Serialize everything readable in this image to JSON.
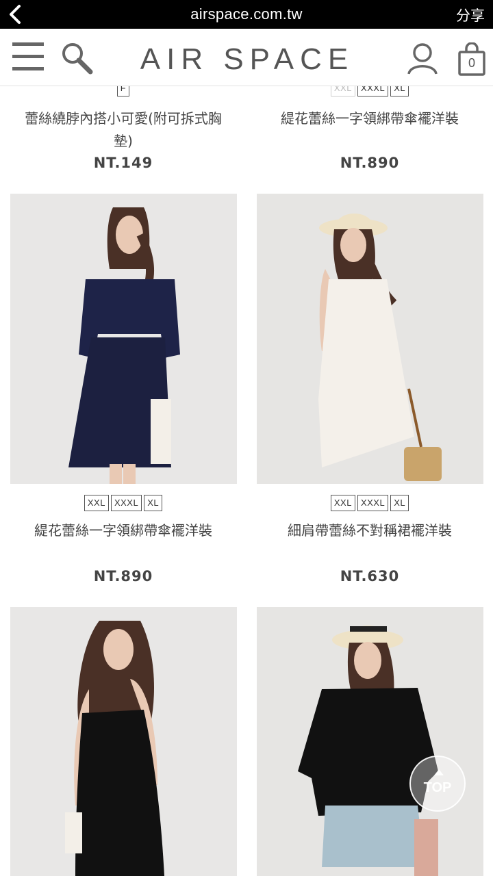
{
  "browser": {
    "url": "airspace.com.tw",
    "share_label": "分享"
  },
  "header": {
    "logo": "AIR SPACE",
    "cart_count": "0"
  },
  "products": [
    {
      "sizes": [
        "F"
      ],
      "name": "蕾絲繞脖內搭小可愛(附可拆式胸墊)",
      "price": "NT.149"
    },
    {
      "sizes": [
        "XXL",
        "XXXL",
        "XL"
      ],
      "name": "緹花蕾絲一字領綁帶傘襬洋裝",
      "price": "NT.890"
    },
    {
      "sizes": [
        "XXL",
        "XXXL",
        "XL"
      ],
      "name": "緹花蕾絲一字領綁帶傘襬洋裝",
      "price": "NT.890"
    },
    {
      "sizes": [
        "XXL",
        "XXXL",
        "XL"
      ],
      "name": "細肩帶蕾絲不對稱裙襬洋裝",
      "price": "NT.630"
    }
  ],
  "back_to_top_label": "TOP",
  "colors": {
    "browser_bar": "#000000",
    "text": "#444444",
    "photo_bg": "#e7e6e5"
  }
}
